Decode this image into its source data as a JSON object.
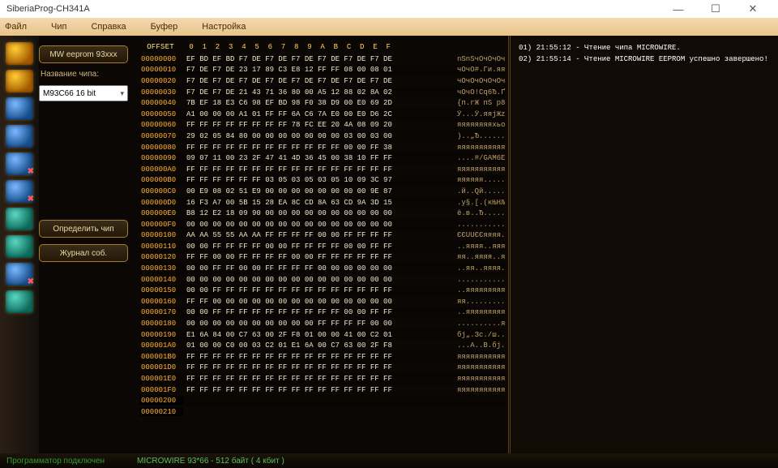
{
  "window": {
    "title": "SiberiaProg-CH341A",
    "min": "—",
    "max": "☐",
    "close": "✕"
  },
  "menu": [
    "Файл",
    "Чип",
    "Справка",
    "Буфер",
    "Настройка"
  ],
  "sidebar": {
    "chip_method": "MW eeprom 93xxx",
    "chip_label": "Название чипа:",
    "chip_select": "M93C66 16 bit",
    "detect": "Определить чип",
    "journal": "Журнал соб."
  },
  "hex": {
    "offset_label": "OFFSET",
    "col_header": " 0  1  2  3  4  5  6  7  8  9  A  B  C  D  E  F",
    "rows": [
      {
        "o": "00000000",
        "h": "EF BD EF BD F7 DE F7 DE F7 DE F7 DE F7 DE F7 DE",
        "a": "nSnSчОчОчОчОчОчО"
      },
      {
        "o": "00000010",
        "h": "F7 DE F7 DE 23 17 89 C3 E8 12 FF FF 08 00 08 01",
        "a": "чОчО#.Ги.яя...."
      },
      {
        "o": "00000020",
        "h": "F7 DE F7 DE F7 DE F7 DE F7 DE F7 DE F7 DE F7 DE",
        "a": "чОчОчОчОчОчОчОчО"
      },
      {
        "o": "00000030",
        "h": "F7 DE F7 DE 21 43 71 36 80 00 A5 12 88 02 8A 02",
        "a": "чОчО!Cq6Ђ.Ґ.Ё.Љ."
      },
      {
        "o": "00000040",
        "h": "7B EF 18 E3 C6 98 EF BD 98 F0 38 D9 00 E0 69 2D",
        "a": "{п.гЖ пЅ р8Щ.аi-"
      },
      {
        "o": "00000050",
        "h": "A1 00 00 00 A1 01 FF FF 6A C6 7A E0 00 E0 D6 2C",
        "a": "Ў...Ў.яяjЖzа.аЦ,"
      },
      {
        "o": "00000060",
        "h": "FF FF FF FF FF FF FF FF 78 FC EE 20 4A 08 09 20",
        "a": "яяяяяяяяxьо J.. "
      },
      {
        "o": "00000070",
        "h": "29 02 05 84 80 00 00 00 00 00 00 00 03 00 03 00",
        "a": ")..„Ђ..........."
      },
      {
        "o": "00000080",
        "h": "FF FF FF FF FF FF FF FF FF FF FF FF 00 00 FF 38",
        "a": "яяяяяяяяяяяя..я8"
      },
      {
        "o": "00000090",
        "h": "09 07 11 00 23 2F 47 41 4D 36 45 00 38 10 FF FF",
        "a": "....#/GAM6E.8.яя"
      },
      {
        "o": "000000A0",
        "h": "FF FF FF FF FF FF FF FF FF FF FF FF FF FF FF FF",
        "a": "яяяяяяяяяяяяяяяя"
      },
      {
        "o": "000000B0",
        "h": "FF FF FF FF FF FF 03 05 03 05 03 05 10 09 3C 97",
        "a": "яяяяяя........<—"
      },
      {
        "o": "000000C0",
        "h": "00 E9 08 02 51 E9 00 00 00 00 00 00 00 00 9E 87",
        "a": ".й..Qй........ћ‡"
      },
      {
        "o": "000000D0",
        "h": "16 F3 A7 00 5B 15 28 EA 8C CD 8A 63 CD 9A 3D 15",
        "a": ".у§.[.(кЊНЉcНљ=."
      },
      {
        "o": "000000E0",
        "h": "B8 12 E2 18 09 90 00 00 00 00 00 00 00 00 00 00",
        "a": "ё.в..Ђ.........."
      },
      {
        "o": "000000F0",
        "h": "00 00 00 00 00 00 00 00 00 00 00 00 00 00 00 00",
        "a": "................"
      },
      {
        "o": "00000100",
        "h": "AA AA 55 55 AA AA FF FF FF FF 00 00 FF FF FF FF",
        "a": "ЄЄUUЄЄяяяя..яяяя"
      },
      {
        "o": "00000110",
        "h": "00 00 FF FF FF FF 00 00 FF FF FF FF 00 00 FF FF",
        "a": "..яяяя..яяяя..яя"
      },
      {
        "o": "00000120",
        "h": "FF FF 00 00 FF FF FF FF 00 00 FF FF FF FF FF FF",
        "a": "яя..яяяя..яяяяяя"
      },
      {
        "o": "00000130",
        "h": "00 00 FF FF 00 00 FF FF FF FF 00 00 00 00 00 00",
        "a": "..яя..яяяя......"
      },
      {
        "o": "00000140",
        "h": "00 00 00 00 00 00 00 00 00 00 00 00 00 00 00 00",
        "a": "................"
      },
      {
        "o": "00000150",
        "h": "00 00 FF FF FF FF FF FF FF FF FF FF FF FF FF FF",
        "a": "..яяяяяяяяяяяяяя"
      },
      {
        "o": "00000160",
        "h": "FF FF 00 00 00 00 00 00 00 00 00 00 00 00 00 00",
        "a": "яя.............."
      },
      {
        "o": "00000170",
        "h": "00 00 FF FF FF FF FF FF FF FF FF FF 00 00 FF FF",
        "a": "..яяяяяяяяяя..яя"
      },
      {
        "o": "00000180",
        "h": "00 00 00 00 00 00 00 00 00 00 FF FF FF FF 00 00",
        "a": "..........яяяя.."
      },
      {
        "o": "00000190",
        "h": "E1 6A 84 00 C7 63 00 2F F8 01 00 00 41 00 C2 01",
        "a": "бj„.Зc./ш...A.В."
      },
      {
        "o": "000001A0",
        "h": "01 00 00 C0 00 03 C2 01 E1 6A 00 C7 63 00 2F F8",
        "a": "...А..В.бj.Зc./ш"
      },
      {
        "o": "000001B0",
        "h": "FF FF FF FF FF FF FF FF FF FF FF FF FF FF FF FF",
        "a": "яяяяяяяяяяяяяяяя"
      },
      {
        "o": "000001D0",
        "h": "FF FF FF FF FF FF FF FF FF FF FF FF FF FF FF FF",
        "a": "яяяяяяяяяяяяяяяя"
      },
      {
        "o": "000001E0",
        "h": "FF FF FF FF FF FF FF FF FF FF FF FF FF FF FF FF",
        "a": "яяяяяяяяяяяяяяяя"
      },
      {
        "o": "000001F0",
        "h": "FF FF FF FF FF FF FF FF FF FF FF FF FF FF FF FF",
        "a": "яяяяяяяяяяяяяяяя"
      },
      {
        "o": "00000200",
        "h": "",
        "a": ""
      },
      {
        "o": "00000210",
        "h": "",
        "a": ""
      }
    ]
  },
  "log": [
    "01) 21:55:12 - Чтение чипа MICROWIRE.",
    "02) 21:55:14 - Чтение MICROWIRE EEPROM успешно завершено!"
  ],
  "status": {
    "conn": "Программатор подключен",
    "info": "MICROWIRE   93*66 - 512 байт ( 4 кбит )"
  }
}
